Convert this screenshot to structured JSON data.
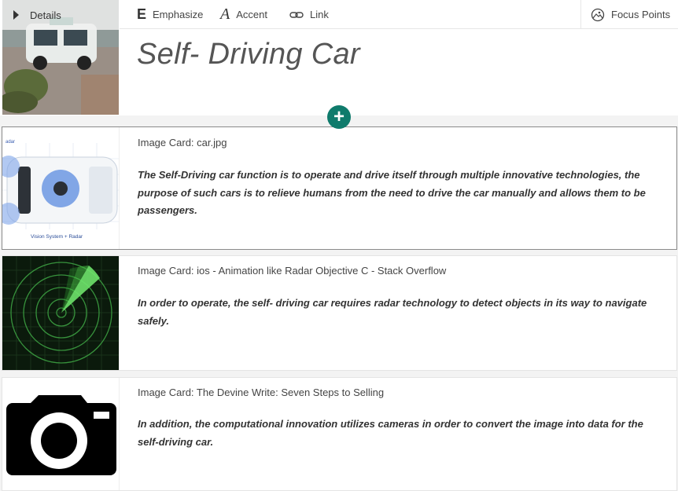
{
  "header": {
    "details_label": "Details",
    "title": "Self- Driving Car"
  },
  "toolbar": {
    "emphasize_label": "Emphasize",
    "accent_label": "Accent",
    "link_label": "Link",
    "focus_points_label": "Focus Points"
  },
  "colors": {
    "accent_green": "#0f7b6c"
  },
  "cards": [
    {
      "caption": "Image Card: car.jpg",
      "body": "The Self-Driving car function is to operate and drive itself through multiple innovative technologies,  the purpose of such cars  is to relieve humans from the need to drive the car manually and allows them to be passengers.",
      "thumb_label": "Vision System + Radar"
    },
    {
      "caption": "Image Card: ios - Animation like Radar Objective C - Stack Overflow",
      "body": "In order to operate, the self- driving car requires radar technology to detect objects in its way  to navigate safely."
    },
    {
      "caption": "Image Card: The Devine Write: Seven Steps to Selling",
      "body": "In addition, the computational innovation utilizes cameras  in order to convert the image into data for the self-driving car."
    }
  ]
}
